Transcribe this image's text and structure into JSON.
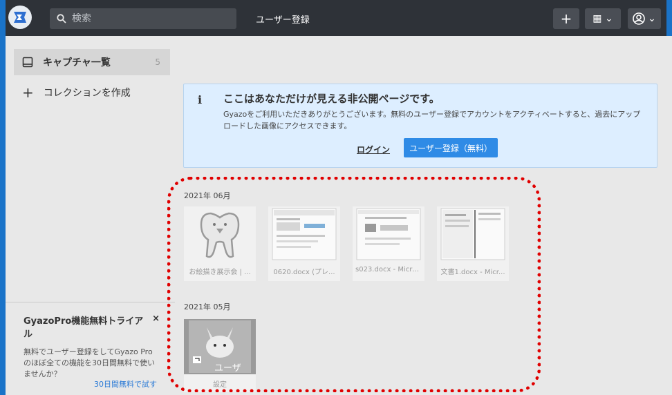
{
  "header": {
    "search_placeholder": "検索",
    "title": "ユーザー登録",
    "add_label": "+",
    "view_label": "▦ ⌄",
    "account_label": "⌄"
  },
  "sidebar": {
    "items": [
      {
        "label": "キャプチャ一覧",
        "count": "5"
      },
      {
        "label": "コレクションを作成"
      }
    ],
    "trial": {
      "title": "GyazoPro機能無料トライアル",
      "close": "×",
      "text": "無料でユーザー登録をしてGyazo Proのほぼ全ての機能を30日間無料で使いませんか？",
      "link": "30日間無料で試す"
    }
  },
  "notice": {
    "icon": "i",
    "title": "ここはあなただけが見える非公開ページです。",
    "text": "Gyazoをご利用いただきありがとうございます。無料のユーザー登録でアカウントをアクティベートすると、過去にアップロードした画像にアクセスできます。",
    "login": "ログイン",
    "register": "ユーザー登録（無料）"
  },
  "groups": [
    {
      "month": "2021年 06月",
      "items": [
        {
          "caption": "お絵描き展示会 | ...",
          "icon": "tooth-drawing-icon"
        },
        {
          "caption": "0620.docx (プレ...",
          "icon": "document-thumbnail-icon"
        },
        {
          "caption": "s023.docx - Micro...",
          "icon": "document-thumbnail-icon"
        },
        {
          "caption": "文書1.docx - Micr...",
          "icon": "document-thumbnail-icon"
        }
      ]
    },
    {
      "month": "2021年 05月",
      "items": [
        {
          "caption": "設定",
          "overlay": "ユーザ",
          "icon": "pikachu-image-icon"
        }
      ]
    }
  ],
  "colors": {
    "topbar": "#2e3238",
    "accent": "#2f8be6",
    "notice_bg": "#ddeeff",
    "highlight": "#e00000"
  }
}
